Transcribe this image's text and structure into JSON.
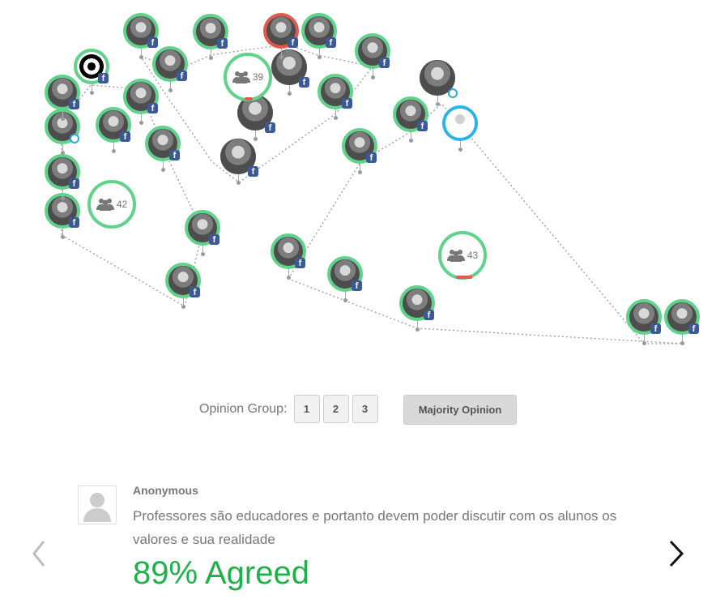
{
  "groups": [
    {
      "id": "group-a",
      "count": "39"
    },
    {
      "id": "group-b",
      "count": "42"
    },
    {
      "id": "group-c",
      "count": "43"
    }
  ],
  "opinion_group": {
    "label": "Opinion Group:",
    "buttons": [
      "1",
      "2",
      "3"
    ],
    "majority_label": "Majority Opinion"
  },
  "comment": {
    "author": "Anonymous",
    "text": "Professores são educadores e portanto devem poder discutir com os alunos os valores e sua realidade",
    "result": "89% Agreed"
  },
  "colors": {
    "agree_ring": "#5fd38a",
    "disagree_ring": "#e6584c",
    "selected_ring": "#2ab2ea",
    "facebook": "#3b5998",
    "result_text": "#1cb24a"
  },
  "icons": {
    "prev": "chevron-left-icon",
    "next": "chevron-right-icon",
    "group": "people-icon",
    "social": "facebook-icon"
  }
}
